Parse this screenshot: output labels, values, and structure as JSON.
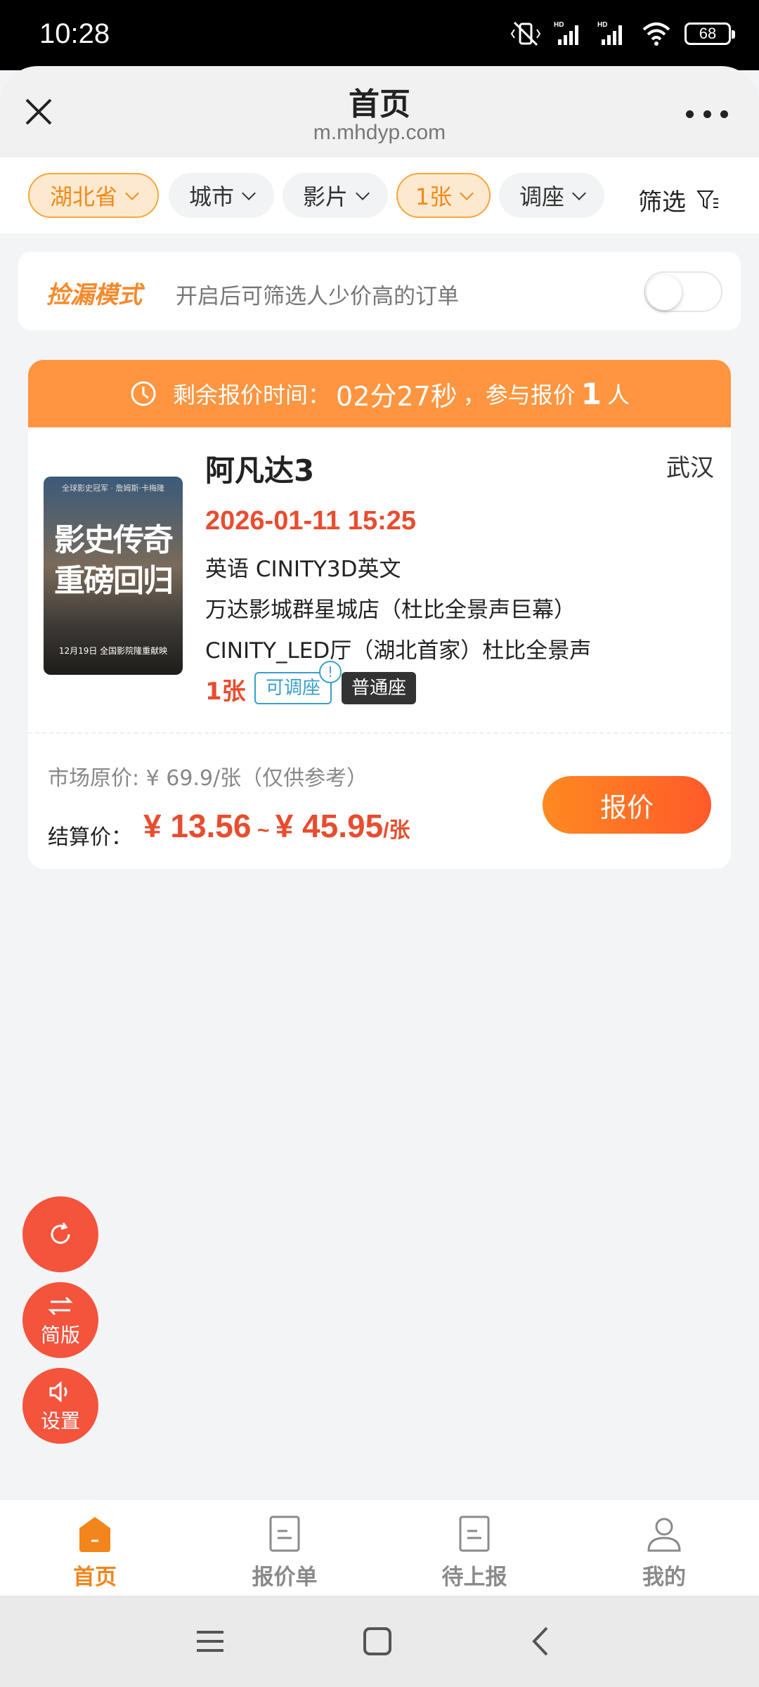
{
  "status_bar": {
    "time": "10:28",
    "battery": "68"
  },
  "browser": {
    "title": "首页",
    "url": "m.mhdyp.com"
  },
  "filters": [
    {
      "label": "湖北省",
      "active": true
    },
    {
      "label": "城市",
      "active": false
    },
    {
      "label": "影片",
      "active": false
    },
    {
      "label": "1张",
      "active": true
    },
    {
      "label": "调座",
      "active": false
    }
  ],
  "filter_button": "筛选",
  "mode": {
    "name": "捡漏模式",
    "description": "开启后可筛选人少价高的订单",
    "enabled": false
  },
  "order": {
    "timer_label": "剩余报价时间：",
    "timer_value": "02分27秒",
    "participants_prefix": "，参与报价",
    "participants_count": "1",
    "participants_suffix": "人",
    "movie_title": "阿凡达3",
    "city": "武汉",
    "showtime": "2026-01-11 15:25",
    "language_format": "英语 CINITY3D英文",
    "cinema": "万达影城群星城店（杜比全景声巨幕）",
    "hall": "CINITY_LED厅（湖北首家）杜比全景声",
    "quantity": "1张",
    "tag_adjustable": "可调座",
    "tag_info": "!",
    "tag_seat": "普通座",
    "market_price": "市场原价: ¥ 69.9/张（仅供参考）",
    "settle_label": "结算价：",
    "settle_min": "¥ 13.56",
    "settle_sep": " ~ ",
    "settle_max": "¥ 45.95",
    "settle_unit": "/张",
    "quote_button": "报价",
    "poster": {
      "top_text": "全球影史冠军 · 詹姆斯·卡梅隆",
      "big_text": "影史传奇重磅回归",
      "date_text": "12月19日 全国影院隆重献映"
    }
  },
  "fabs": [
    {
      "icon": "refresh-icon",
      "label": ""
    },
    {
      "icon": "swap-icon",
      "label": "简版"
    },
    {
      "icon": "speaker-icon",
      "label": "设置"
    }
  ],
  "bottom_nav": [
    {
      "label": "首页",
      "icon": "home-icon",
      "active": true
    },
    {
      "label": "报价单",
      "icon": "document-icon",
      "active": false
    },
    {
      "label": "待上报",
      "icon": "document-icon",
      "active": false
    },
    {
      "label": "我的",
      "icon": "user-icon",
      "active": false
    }
  ],
  "colors": {
    "accent": "#ff9540",
    "price": "#e84d2f",
    "fab": "#f4533c",
    "nav_active": "#f2851b"
  }
}
